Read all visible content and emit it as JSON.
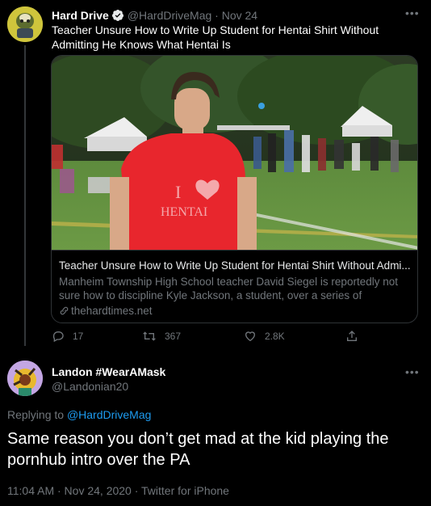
{
  "tweet1": {
    "name": "Hard Drive",
    "handle": "@HardDriveMag",
    "separator": " · ",
    "date": "Nov 24",
    "text": "Teacher Unsure How to Write Up Student for Hentai Shirt Without Admitting He Knows What Hentai Is",
    "more": "•••",
    "card": {
      "shirt_text_i": "I",
      "shirt_text_word": "HENTAI",
      "title": "Teacher Unsure How to Write Up Student for Hentai Shirt Without Admi...",
      "description": "Manheim Township High School teacher David Siegel is reportedly not sure how to discipline Kyle Jackson, a student, over a series of Hentai-...",
      "domain": "thehardtimes.net"
    },
    "actions": {
      "replies": "17",
      "retweets": "367",
      "likes": "2.8K"
    }
  },
  "tweet2": {
    "name": "Landon #WearAMask",
    "handle": "@Landonian20",
    "more": "•••",
    "replying_prefix": "Replying to ",
    "replying_handle": "@HardDriveMag",
    "text": "Same reason you don’t get mad at the kid playing the pornhub intro over the PA",
    "timestamp": "11:04 AM · Nov 24, 2020 · Twitter for iPhone"
  },
  "colors": {
    "background": "#000000",
    "accent": "#1d9bf0",
    "secondary_text": "#71767b",
    "shirt_red": "#e8262d"
  }
}
